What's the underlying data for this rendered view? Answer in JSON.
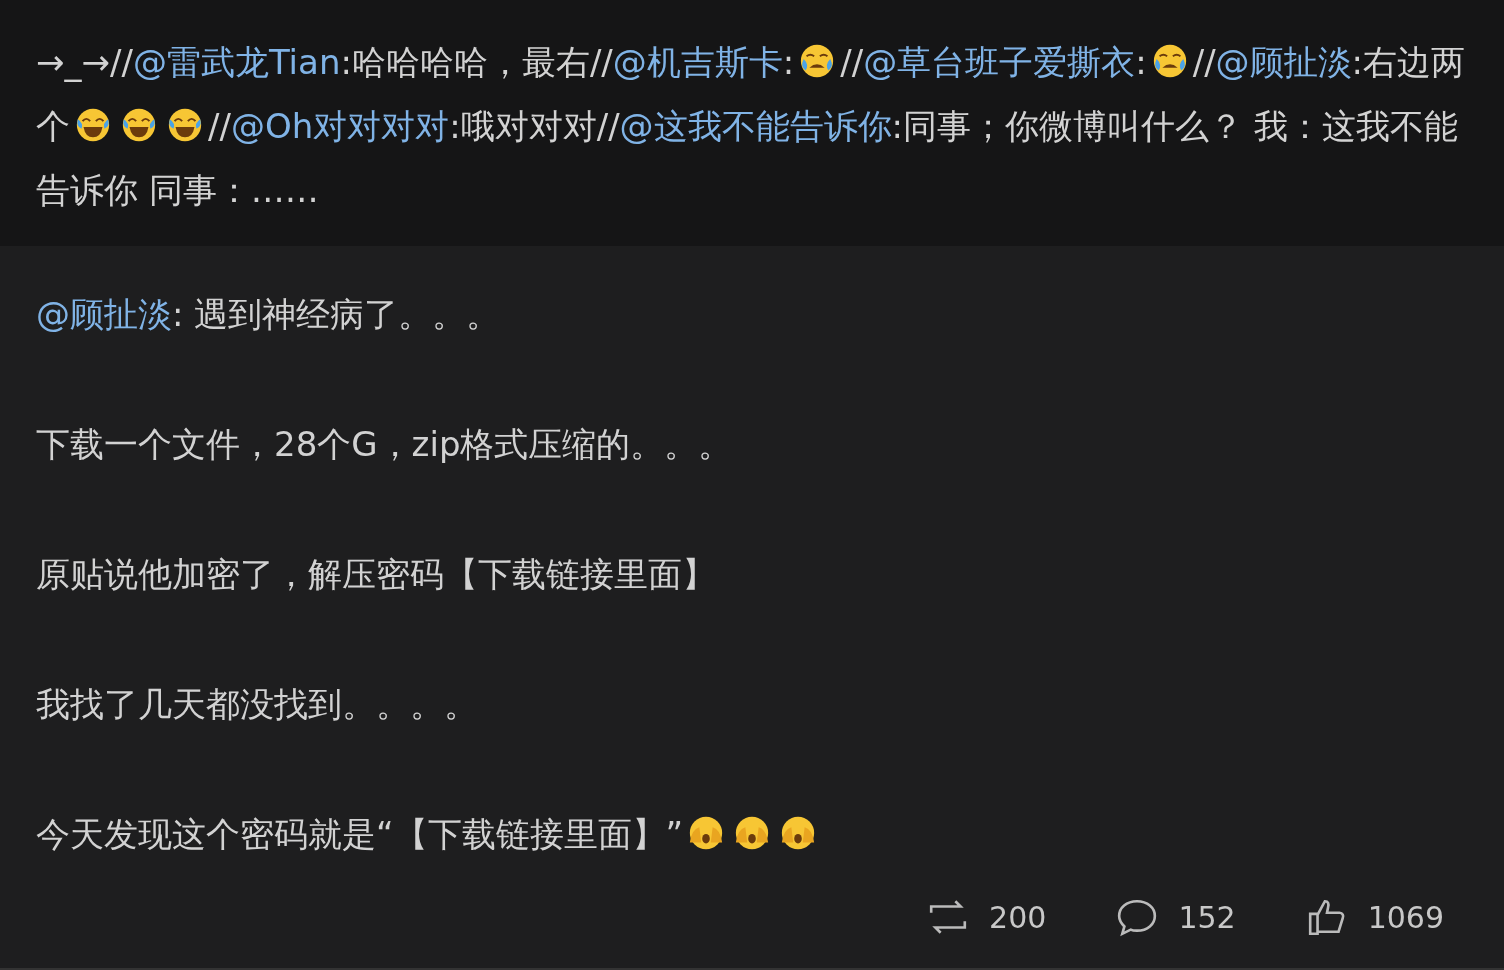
{
  "repost": {
    "segments": [
      {
        "kind": "text",
        "text": "→_→//"
      },
      {
        "kind": "mention",
        "text": "@雷武龙Tian"
      },
      {
        "kind": "text",
        "text": ":哈哈哈哈，最右//"
      },
      {
        "kind": "mention",
        "text": "@机吉斯卡"
      },
      {
        "kind": "text",
        "text": ":"
      },
      {
        "kind": "cry-emoji"
      },
      {
        "kind": "text",
        "text": "//"
      },
      {
        "kind": "mention",
        "text": "@草台班子爱撕衣"
      },
      {
        "kind": "text",
        "text": ":"
      },
      {
        "kind": "cry-emoji"
      },
      {
        "kind": "text",
        "text": "//"
      },
      {
        "kind": "mention",
        "text": "@顾扯淡"
      },
      {
        "kind": "text",
        "text": ":右边两个"
      },
      {
        "kind": "laugh-emoji"
      },
      {
        "kind": "laugh-emoji"
      },
      {
        "kind": "laugh-emoji"
      },
      {
        "kind": "text",
        "text": "//"
      },
      {
        "kind": "mention",
        "text": "@Oh对对对对"
      },
      {
        "kind": "text",
        "text": ":哦对对对//"
      },
      {
        "kind": "mention",
        "text": "@这我不能告诉你"
      },
      {
        "kind": "text",
        "text": ":同事；你微博叫什么？ 我：这我不能告诉你 同事：……"
      }
    ]
  },
  "post": {
    "paragraphs": [
      {
        "segments": [
          {
            "kind": "mention",
            "text": "@顾扯淡"
          },
          {
            "kind": "text",
            "text": ": 遇到神经病了。。。"
          }
        ]
      },
      {
        "segments": [
          {
            "kind": "text",
            "text": "下载一个文件，28个G，zip格式压缩的。。。"
          }
        ]
      },
      {
        "segments": [
          {
            "kind": "text",
            "text": "原贴说他加密了，解压密码【下载链接里面】"
          }
        ]
      },
      {
        "segments": [
          {
            "kind": "text",
            "text": "我找了几天都没找到。。。。"
          }
        ]
      },
      {
        "segments": [
          {
            "kind": "text",
            "text": "今天发现这个密码就是“【下载链接里面】”"
          },
          {
            "kind": "hands-emoji"
          },
          {
            "kind": "hands-emoji"
          },
          {
            "kind": "hands-emoji"
          }
        ]
      }
    ]
  },
  "actions": [
    {
      "kind": "repost",
      "count": "200"
    },
    {
      "kind": "comment",
      "count": "152"
    },
    {
      "kind": "like",
      "count": "1069"
    }
  ]
}
